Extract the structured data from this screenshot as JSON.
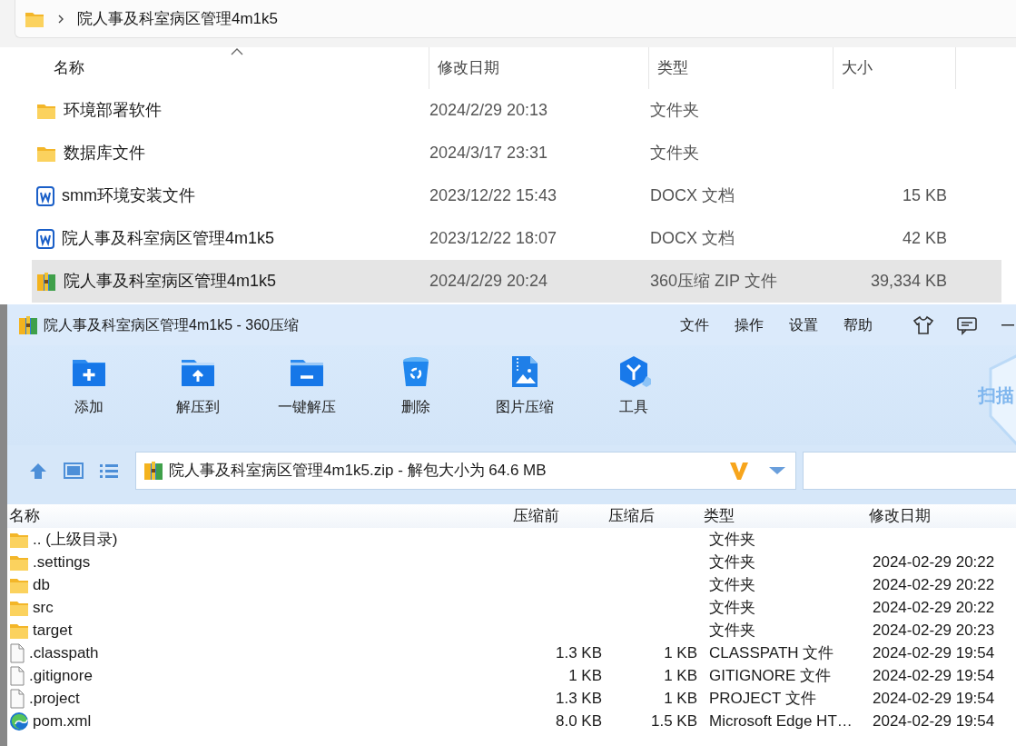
{
  "explorer": {
    "breadcrumb": "院人事及科室病区管理4m1k5",
    "columns": [
      {
        "label": "名称",
        "sorted": true
      },
      {
        "label": "修改日期",
        "sorted": false
      },
      {
        "label": "类型",
        "sorted": false
      },
      {
        "label": "大小",
        "sorted": false
      }
    ],
    "files": [
      {
        "kind": "folder",
        "name": "环境部署软件",
        "modified": "2024/2/29 20:13",
        "type": "文件夹",
        "selected": false
      },
      {
        "kind": "folder",
        "name": "数据库文件",
        "modified": "2024/3/17 23:31",
        "type": "文件夹",
        "selected": false
      },
      {
        "kind": "docx",
        "name": "smm环境安装文件",
        "modified": "2023/12/22 15:43",
        "type": "DOCX 文档",
        "size": "15 KB",
        "selected": false
      },
      {
        "kind": "docx",
        "name": "院人事及科室病区管理4m1k5",
        "modified": "2023/12/22 18:07",
        "type": "DOCX 文档",
        "size": "42 KB",
        "selected": false
      },
      {
        "kind": "zip",
        "name": "院人事及科室病区管理4m1k5",
        "modified": "2024/2/29 20:24",
        "type": "360压缩 ZIP 文件",
        "size": "39,334 KB",
        "selected": true
      }
    ]
  },
  "zip_window": {
    "title": "院人事及科室病区管理4m1k5 - 360压缩",
    "menu": [
      "文件",
      "操作",
      "设置",
      "帮助"
    ],
    "tools": [
      {
        "kind": "add",
        "label": "添加"
      },
      {
        "kind": "extract",
        "label": "解压到"
      },
      {
        "kind": "quick",
        "label": "一键解压"
      },
      {
        "kind": "delete",
        "label": "删除"
      },
      {
        "kind": "image",
        "label": "图片压缩"
      },
      {
        "kind": "tools",
        "label": "工具"
      }
    ],
    "scan_label": "扫描",
    "address": "院人事及科室病区管理4m1k5.zip - 解包大小为 64.6 MB",
    "columns": [
      "名称",
      "压缩前",
      "压缩后",
      "类型",
      "修改日期"
    ],
    "entries": [
      {
        "kind": "folder",
        "name": ".. (上级目录)",
        "type": "文件夹"
      },
      {
        "kind": "folder",
        "name": ".settings",
        "type": "文件夹",
        "modified": "2024-02-29 20:22"
      },
      {
        "kind": "folder",
        "name": "db",
        "type": "文件夹",
        "modified": "2024-02-29 20:22"
      },
      {
        "kind": "folder",
        "name": "src",
        "type": "文件夹",
        "modified": "2024-02-29 20:22"
      },
      {
        "kind": "folder",
        "name": "target",
        "type": "文件夹",
        "modified": "2024-02-29 20:23"
      },
      {
        "kind": "file",
        "name": ".classpath",
        "size_before": "1.3 KB",
        "size_after": "1 KB",
        "type": "CLASSPATH 文件",
        "modified": "2024-02-29 19:54"
      },
      {
        "kind": "file",
        "name": ".gitignore",
        "size_before": "1 KB",
        "size_after": "1 KB",
        "type": "GITIGNORE 文件",
        "modified": "2024-02-29 19:54"
      },
      {
        "kind": "file",
        "name": ".project",
        "size_before": "1.3 KB",
        "size_after": "1 KB",
        "type": "PROJECT 文件",
        "modified": "2024-02-29 19:54"
      },
      {
        "kind": "edge",
        "name": "pom.xml",
        "size_before": "8.0 KB",
        "size_after": "1.5 KB",
        "type": "Microsoft Edge HT…",
        "modified": "2024-02-29 19:54"
      }
    ]
  }
}
